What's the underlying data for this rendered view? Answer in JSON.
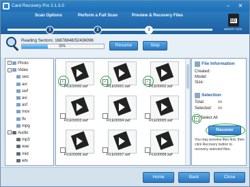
{
  "window": {
    "title": "Card Recovery Pro 2.1.3.0",
    "minimize": "–",
    "close": "✕"
  },
  "steps": {
    "items": [
      {
        "number": "1",
        "label": "Scan Options"
      },
      {
        "number": "2",
        "label": "Perform a Full Scan"
      },
      {
        "number": "3",
        "label": "Preview & Recovery Files"
      }
    ],
    "active": 3,
    "card_label": "SD",
    "brand": "MEMORY CARD"
  },
  "scan": {
    "reading_label": "Reading Sectors:",
    "sectors": "16878848/52436096",
    "percent": "32%",
    "progress": 0.32,
    "resume": "Resume",
    "stop": "Stop"
  },
  "tree": [
    {
      "label": "Photo",
      "expander": "+",
      "type": "folder",
      "level": 0
    },
    {
      "label": "Video",
      "expander": "–",
      "type": "folder",
      "level": 0
    },
    {
      "label": "swc",
      "type": "folder",
      "level": 1
    },
    {
      "label": "avi",
      "type": "folder",
      "level": 1
    },
    {
      "label": "swf",
      "type": "folder",
      "level": 1
    },
    {
      "label": "avi",
      "type": "folder",
      "level": 1
    },
    {
      "label": "asf",
      "type": "folder",
      "level": 1
    },
    {
      "label": "mov",
      "type": "folder",
      "level": 1
    },
    {
      "label": "flv",
      "type": "folder",
      "level": 1
    },
    {
      "label": "mpg",
      "type": "folder",
      "level": 1
    },
    {
      "label": "Audio",
      "expander": "–",
      "type": "audio",
      "level": 0
    },
    {
      "label": "mp3",
      "type": "audio",
      "level": 1
    },
    {
      "label": "wav",
      "type": "audio",
      "level": 1
    },
    {
      "label": "mid",
      "type": "audio",
      "level": 1
    },
    {
      "label": "wtv",
      "type": "audio",
      "level": 1
    }
  ],
  "files": [
    {
      "name": "FILE00000.swf",
      "checked": true
    },
    {
      "name": "FILE00001.swf",
      "checked": true
    },
    {
      "name": "FILE00002.swf",
      "checked": true
    },
    {
      "name": "FILE00003.swf",
      "checked": false
    },
    {
      "name": "FILE00004.swf",
      "checked": false
    },
    {
      "name": "FILE00005.swf",
      "checked": false
    },
    {
      "name": "FILE00006.swf",
      "checked": false
    },
    {
      "name": "FILE00007.swf",
      "checked": false
    },
    {
      "name": "FILE00008.swf",
      "checked": false
    }
  ],
  "info": {
    "title": "File Information",
    "created": "Created:",
    "model": "Model:",
    "size": "Size:"
  },
  "selection": {
    "title": "Selection",
    "total_label": "Total:",
    "total": "94",
    "selected_label": "Selected:",
    "selected": "94",
    "select_all": "Select All",
    "select_all_checked": true,
    "recover": "Recover",
    "tip": "You may preview files first, then click Recovery button to recovery selected files."
  },
  "footer": {
    "home": "Home",
    "back": "Back",
    "close": "Close"
  }
}
